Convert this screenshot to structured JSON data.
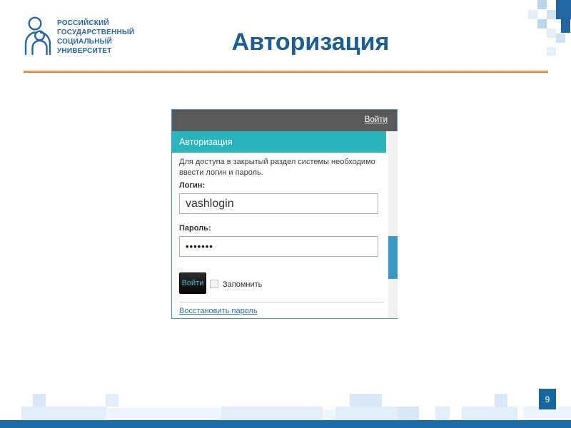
{
  "colors": {
    "accent_orange": "#e8823c",
    "title_blue": "#1b5e97",
    "logo_blue": "#2565a8",
    "teal": "#2ab5bd",
    "header_gray": "#595959",
    "bottom_bar_blue": "#1c6ba6",
    "page_box_blue": "#15679e",
    "scroll_thumb_blue": "#3f96c9",
    "link_blue": "#3572b0",
    "button_text_teal": "#4fb7cd"
  },
  "logo": {
    "lines": [
      "РОССИЙСКИЙ",
      "ГОСУДАРСТВЕННЫЙ",
      "СОЦИАЛЬНЫЙ",
      "УНИВЕРСИТЕТ"
    ]
  },
  "slide": {
    "title": "Авторизация",
    "page_number": "9"
  },
  "dialog": {
    "toolbar_link": "Войти",
    "title": "Авторизация",
    "instruction": "Для доступа в закрытый раздел системы необходимо ввести логин и пароль.",
    "login": {
      "label": "Логин:",
      "value": "vashlogin"
    },
    "password": {
      "label": "Пароль:",
      "value": "•••••••"
    },
    "submit_label": "Войти",
    "remember_label": "Запомнить",
    "recover_link": "Восстановить пароль"
  }
}
